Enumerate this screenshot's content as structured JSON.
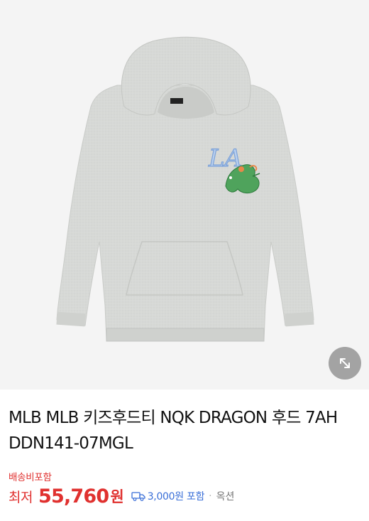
{
  "product": {
    "title": "MLB MLB 키즈후드티 NQK DRAGON 후드 7AH DDN141-07MGL",
    "image_alt": "MLB kids hoodie gray with LA logo and dragon"
  },
  "shipping": {
    "included_note": "배송비포함",
    "fee": "3,000원 포함",
    "separator": "·",
    "option": "옥션"
  },
  "price": {
    "label": "최저",
    "value": "55,760",
    "unit": "원"
  },
  "icons": {
    "expand": "expand-diagonal-icon",
    "truck": "delivery-truck-icon"
  },
  "colors": {
    "price_red": "#e0312f",
    "shipping_blue": "#3a6fd8",
    "image_bg": "#f4f4f4",
    "expand_bg": "#a3a3a3"
  }
}
